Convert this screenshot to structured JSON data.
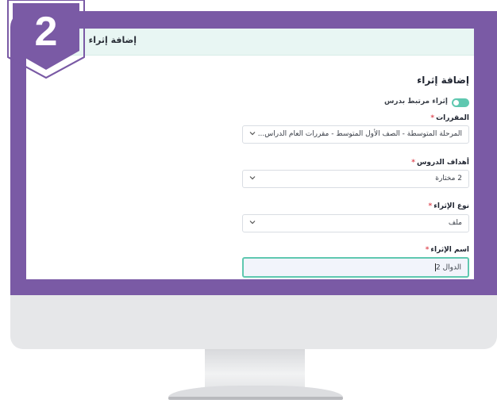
{
  "badge": {
    "number": "2"
  },
  "header": {
    "title": "إضافة إثراء"
  },
  "form": {
    "section_title": "إضافة إثراء",
    "toggle": {
      "label": "إثراء مرتبط بدرس",
      "on": true
    },
    "courses": {
      "label": "المقررات",
      "required_mark": "*",
      "value": "المرحلة المتوسطة - الصف الأول المتوسط - مقررات العام الدراس..."
    },
    "lesson_goals": {
      "label": "أهداف الدروس",
      "required_mark": "*",
      "value": "2 مختارة"
    },
    "enrichment_type": {
      "label": "نوع الإثراء",
      "required_mark": "*",
      "value": "ملف"
    },
    "enrichment_name": {
      "label": "اسم الإثراء",
      "required_mark": "*",
      "value": "الدوال 2"
    }
  },
  "colors": {
    "frame": "#7a5aa5",
    "accent": "#5fc8b0",
    "header_bg": "#e8f6f3",
    "required": "#e0505a"
  }
}
